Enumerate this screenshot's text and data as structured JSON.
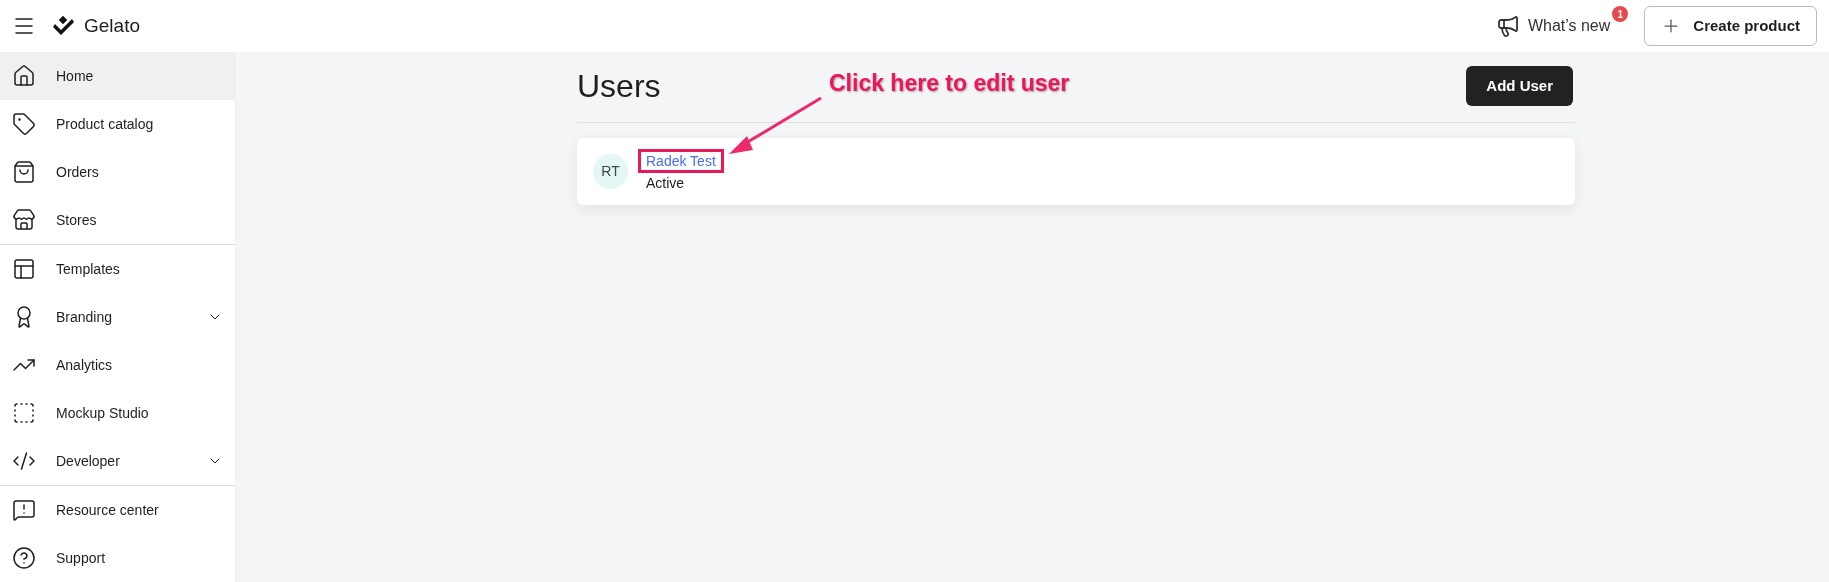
{
  "header": {
    "logo": "Gelato",
    "whats_new": {
      "label": "What’s new",
      "badge": "1"
    },
    "create_button": {
      "label": "Create product"
    }
  },
  "sidebar": {
    "sections": [
      {
        "items": [
          {
            "label": "Home",
            "selected": true,
            "expandable": false
          },
          {
            "label": "Product catalog",
            "selected": false,
            "expandable": false
          },
          {
            "label": "Orders",
            "selected": false,
            "expandable": false
          },
          {
            "label": "Stores",
            "selected": false,
            "expandable": false
          }
        ]
      },
      {
        "items": [
          {
            "label": "Templates",
            "selected": false,
            "expandable": false
          },
          {
            "label": "Branding",
            "selected": false,
            "expandable": true
          },
          {
            "label": "Analytics",
            "selected": false,
            "expandable": false
          },
          {
            "label": "Mockup Studio",
            "selected": false,
            "expandable": false
          },
          {
            "label": "Developer",
            "selected": false,
            "expandable": true
          }
        ]
      },
      {
        "items": [
          {
            "label": "Resource center",
            "selected": false,
            "expandable": false
          },
          {
            "label": "Support",
            "selected": false,
            "expandable": false
          }
        ]
      }
    ]
  },
  "page": {
    "title": "Users",
    "add_button": "Add User",
    "users": [
      {
        "initials": "RT",
        "name": "Radek Test",
        "status": "Active",
        "highlighted": true
      }
    ]
  },
  "annotation": {
    "text": "Click here to edit user"
  }
}
